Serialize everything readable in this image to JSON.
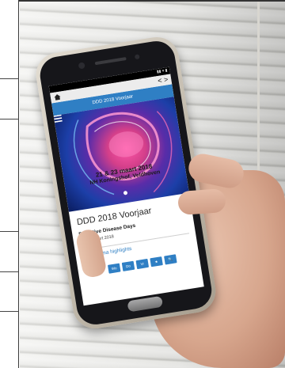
{
  "browser": {
    "home_icon": "home-icon",
    "nav_icons": [
      "chevron-left-icon",
      "chevron-right-icon"
    ],
    "arrows": "< >"
  },
  "app": {
    "header_title": "DDD 2018 Voorjaar",
    "menu_icon": "hamburger-icon",
    "accent_color": "#2f7fc4",
    "hero": {
      "date_text": "21 & 23 maart 2018",
      "venue_text": "NH Koningshof, Veldhoven"
    },
    "title": "DDD 2018 Voorjaar",
    "subtitle": "Digestive Disease Days",
    "dates": "21-23 maart 2018",
    "highlights_link": "Programma highlights",
    "toolbar": [
      {
        "label": "Wo"
      },
      {
        "label": "Do"
      },
      {
        "label": "Vr"
      },
      {
        "label": "★"
      },
      {
        "label": "🔍"
      }
    ]
  }
}
